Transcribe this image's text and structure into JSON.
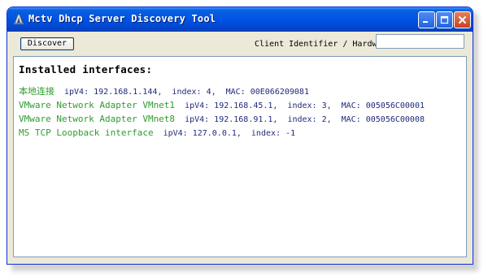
{
  "window": {
    "title": "Mctv Dhcp Server Discovery Tool"
  },
  "toolbar": {
    "discover_label": "Discover",
    "client_id_label": "Client Identifier / Hardware Address",
    "client_id_value": ""
  },
  "output": {
    "heading": "Installed interfaces:",
    "interfaces": [
      {
        "name": "本地连接",
        "ipv4": "ipV4: 192.168.1.144,",
        "index": "index: 4,",
        "mac": "MAC: 00E066209081"
      },
      {
        "name": "VMware Network Adapter VMnet1",
        "ipv4": "ipV4: 192.168.45.1,",
        "index": "index: 3,",
        "mac": "MAC: 005056C00001"
      },
      {
        "name": "VMware Network Adapter VMnet8",
        "ipv4": "ipV4: 192.168.91.1,",
        "index": "index: 2,",
        "mac": "MAC: 005056C00008"
      },
      {
        "name": "MS TCP Loopback interface",
        "ipv4": "ipV4: 127.0.0.1,",
        "index": "index: -1",
        "mac": ""
      }
    ]
  },
  "colors": {
    "interface_name": "#2e9c2e",
    "interface_detail": "#1f2a7a",
    "titlebar": "#0055e5",
    "window_face": "#ece9d8"
  },
  "icons": {
    "app": "app-icon",
    "minimize": "minimize-icon",
    "maximize": "maximize-icon",
    "close": "close-icon"
  }
}
